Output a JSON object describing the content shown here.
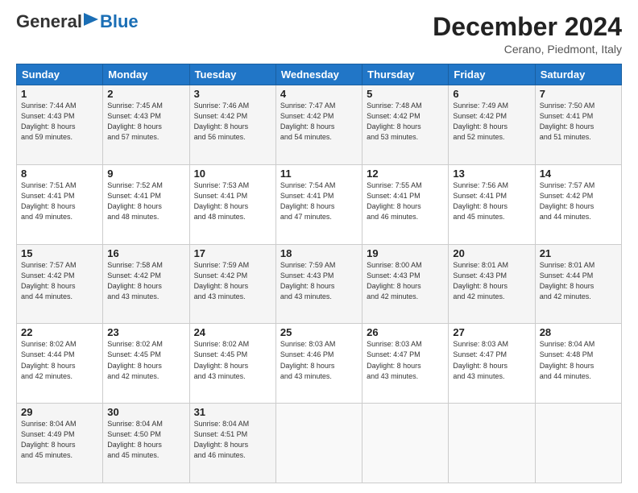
{
  "header": {
    "logo_general": "General",
    "logo_blue": "Blue",
    "month_title": "December 2024",
    "location": "Cerano, Piedmont, Italy"
  },
  "calendar": {
    "days_of_week": [
      "Sunday",
      "Monday",
      "Tuesday",
      "Wednesday",
      "Thursday",
      "Friday",
      "Saturday"
    ],
    "weeks": [
      [
        null,
        {
          "day": "2",
          "sunrise": "7:45 AM",
          "sunset": "4:43 PM",
          "daylight": "8 hours and 57 minutes."
        },
        {
          "day": "3",
          "sunrise": "7:46 AM",
          "sunset": "4:42 PM",
          "daylight": "8 hours and 56 minutes."
        },
        {
          "day": "4",
          "sunrise": "7:47 AM",
          "sunset": "4:42 PM",
          "daylight": "8 hours and 54 minutes."
        },
        {
          "day": "5",
          "sunrise": "7:48 AM",
          "sunset": "4:42 PM",
          "daylight": "8 hours and 53 minutes."
        },
        {
          "day": "6",
          "sunrise": "7:49 AM",
          "sunset": "4:42 PM",
          "daylight": "8 hours and 52 minutes."
        },
        {
          "day": "7",
          "sunrise": "7:50 AM",
          "sunset": "4:41 PM",
          "daylight": "8 hours and 51 minutes."
        }
      ],
      [
        {
          "day": "1",
          "sunrise": "7:44 AM",
          "sunset": "4:43 PM",
          "daylight": "8 hours and 59 minutes."
        },
        null,
        null,
        null,
        null,
        null,
        null
      ],
      [
        {
          "day": "8",
          "sunrise": "7:51 AM",
          "sunset": "4:41 PM",
          "daylight": "8 hours and 49 minutes."
        },
        {
          "day": "9",
          "sunrise": "7:52 AM",
          "sunset": "4:41 PM",
          "daylight": "8 hours and 48 minutes."
        },
        {
          "day": "10",
          "sunrise": "7:53 AM",
          "sunset": "4:41 PM",
          "daylight": "8 hours and 48 minutes."
        },
        {
          "day": "11",
          "sunrise": "7:54 AM",
          "sunset": "4:41 PM",
          "daylight": "8 hours and 47 minutes."
        },
        {
          "day": "12",
          "sunrise": "7:55 AM",
          "sunset": "4:41 PM",
          "daylight": "8 hours and 46 minutes."
        },
        {
          "day": "13",
          "sunrise": "7:56 AM",
          "sunset": "4:41 PM",
          "daylight": "8 hours and 45 minutes."
        },
        {
          "day": "14",
          "sunrise": "7:57 AM",
          "sunset": "4:42 PM",
          "daylight": "8 hours and 44 minutes."
        }
      ],
      [
        {
          "day": "15",
          "sunrise": "7:57 AM",
          "sunset": "4:42 PM",
          "daylight": "8 hours and 44 minutes."
        },
        {
          "day": "16",
          "sunrise": "7:58 AM",
          "sunset": "4:42 PM",
          "daylight": "8 hours and 43 minutes."
        },
        {
          "day": "17",
          "sunrise": "7:59 AM",
          "sunset": "4:42 PM",
          "daylight": "8 hours and 43 minutes."
        },
        {
          "day": "18",
          "sunrise": "7:59 AM",
          "sunset": "4:43 PM",
          "daylight": "8 hours and 43 minutes."
        },
        {
          "day": "19",
          "sunrise": "8:00 AM",
          "sunset": "4:43 PM",
          "daylight": "8 hours and 42 minutes."
        },
        {
          "day": "20",
          "sunrise": "8:01 AM",
          "sunset": "4:43 PM",
          "daylight": "8 hours and 42 minutes."
        },
        {
          "day": "21",
          "sunrise": "8:01 AM",
          "sunset": "4:44 PM",
          "daylight": "8 hours and 42 minutes."
        }
      ],
      [
        {
          "day": "22",
          "sunrise": "8:02 AM",
          "sunset": "4:44 PM",
          "daylight": "8 hours and 42 minutes."
        },
        {
          "day": "23",
          "sunrise": "8:02 AM",
          "sunset": "4:45 PM",
          "daylight": "8 hours and 42 minutes."
        },
        {
          "day": "24",
          "sunrise": "8:02 AM",
          "sunset": "4:45 PM",
          "daylight": "8 hours and 43 minutes."
        },
        {
          "day": "25",
          "sunrise": "8:03 AM",
          "sunset": "4:46 PM",
          "daylight": "8 hours and 43 minutes."
        },
        {
          "day": "26",
          "sunrise": "8:03 AM",
          "sunset": "4:47 PM",
          "daylight": "8 hours and 43 minutes."
        },
        {
          "day": "27",
          "sunrise": "8:03 AM",
          "sunset": "4:47 PM",
          "daylight": "8 hours and 43 minutes."
        },
        {
          "day": "28",
          "sunrise": "8:04 AM",
          "sunset": "4:48 PM",
          "daylight": "8 hours and 44 minutes."
        }
      ],
      [
        {
          "day": "29",
          "sunrise": "8:04 AM",
          "sunset": "4:49 PM",
          "daylight": "8 hours and 45 minutes."
        },
        {
          "day": "30",
          "sunrise": "8:04 AM",
          "sunset": "4:50 PM",
          "daylight": "8 hours and 45 minutes."
        },
        {
          "day": "31",
          "sunrise": "8:04 AM",
          "sunset": "4:51 PM",
          "daylight": "8 hours and 46 minutes."
        },
        null,
        null,
        null,
        null
      ]
    ]
  }
}
